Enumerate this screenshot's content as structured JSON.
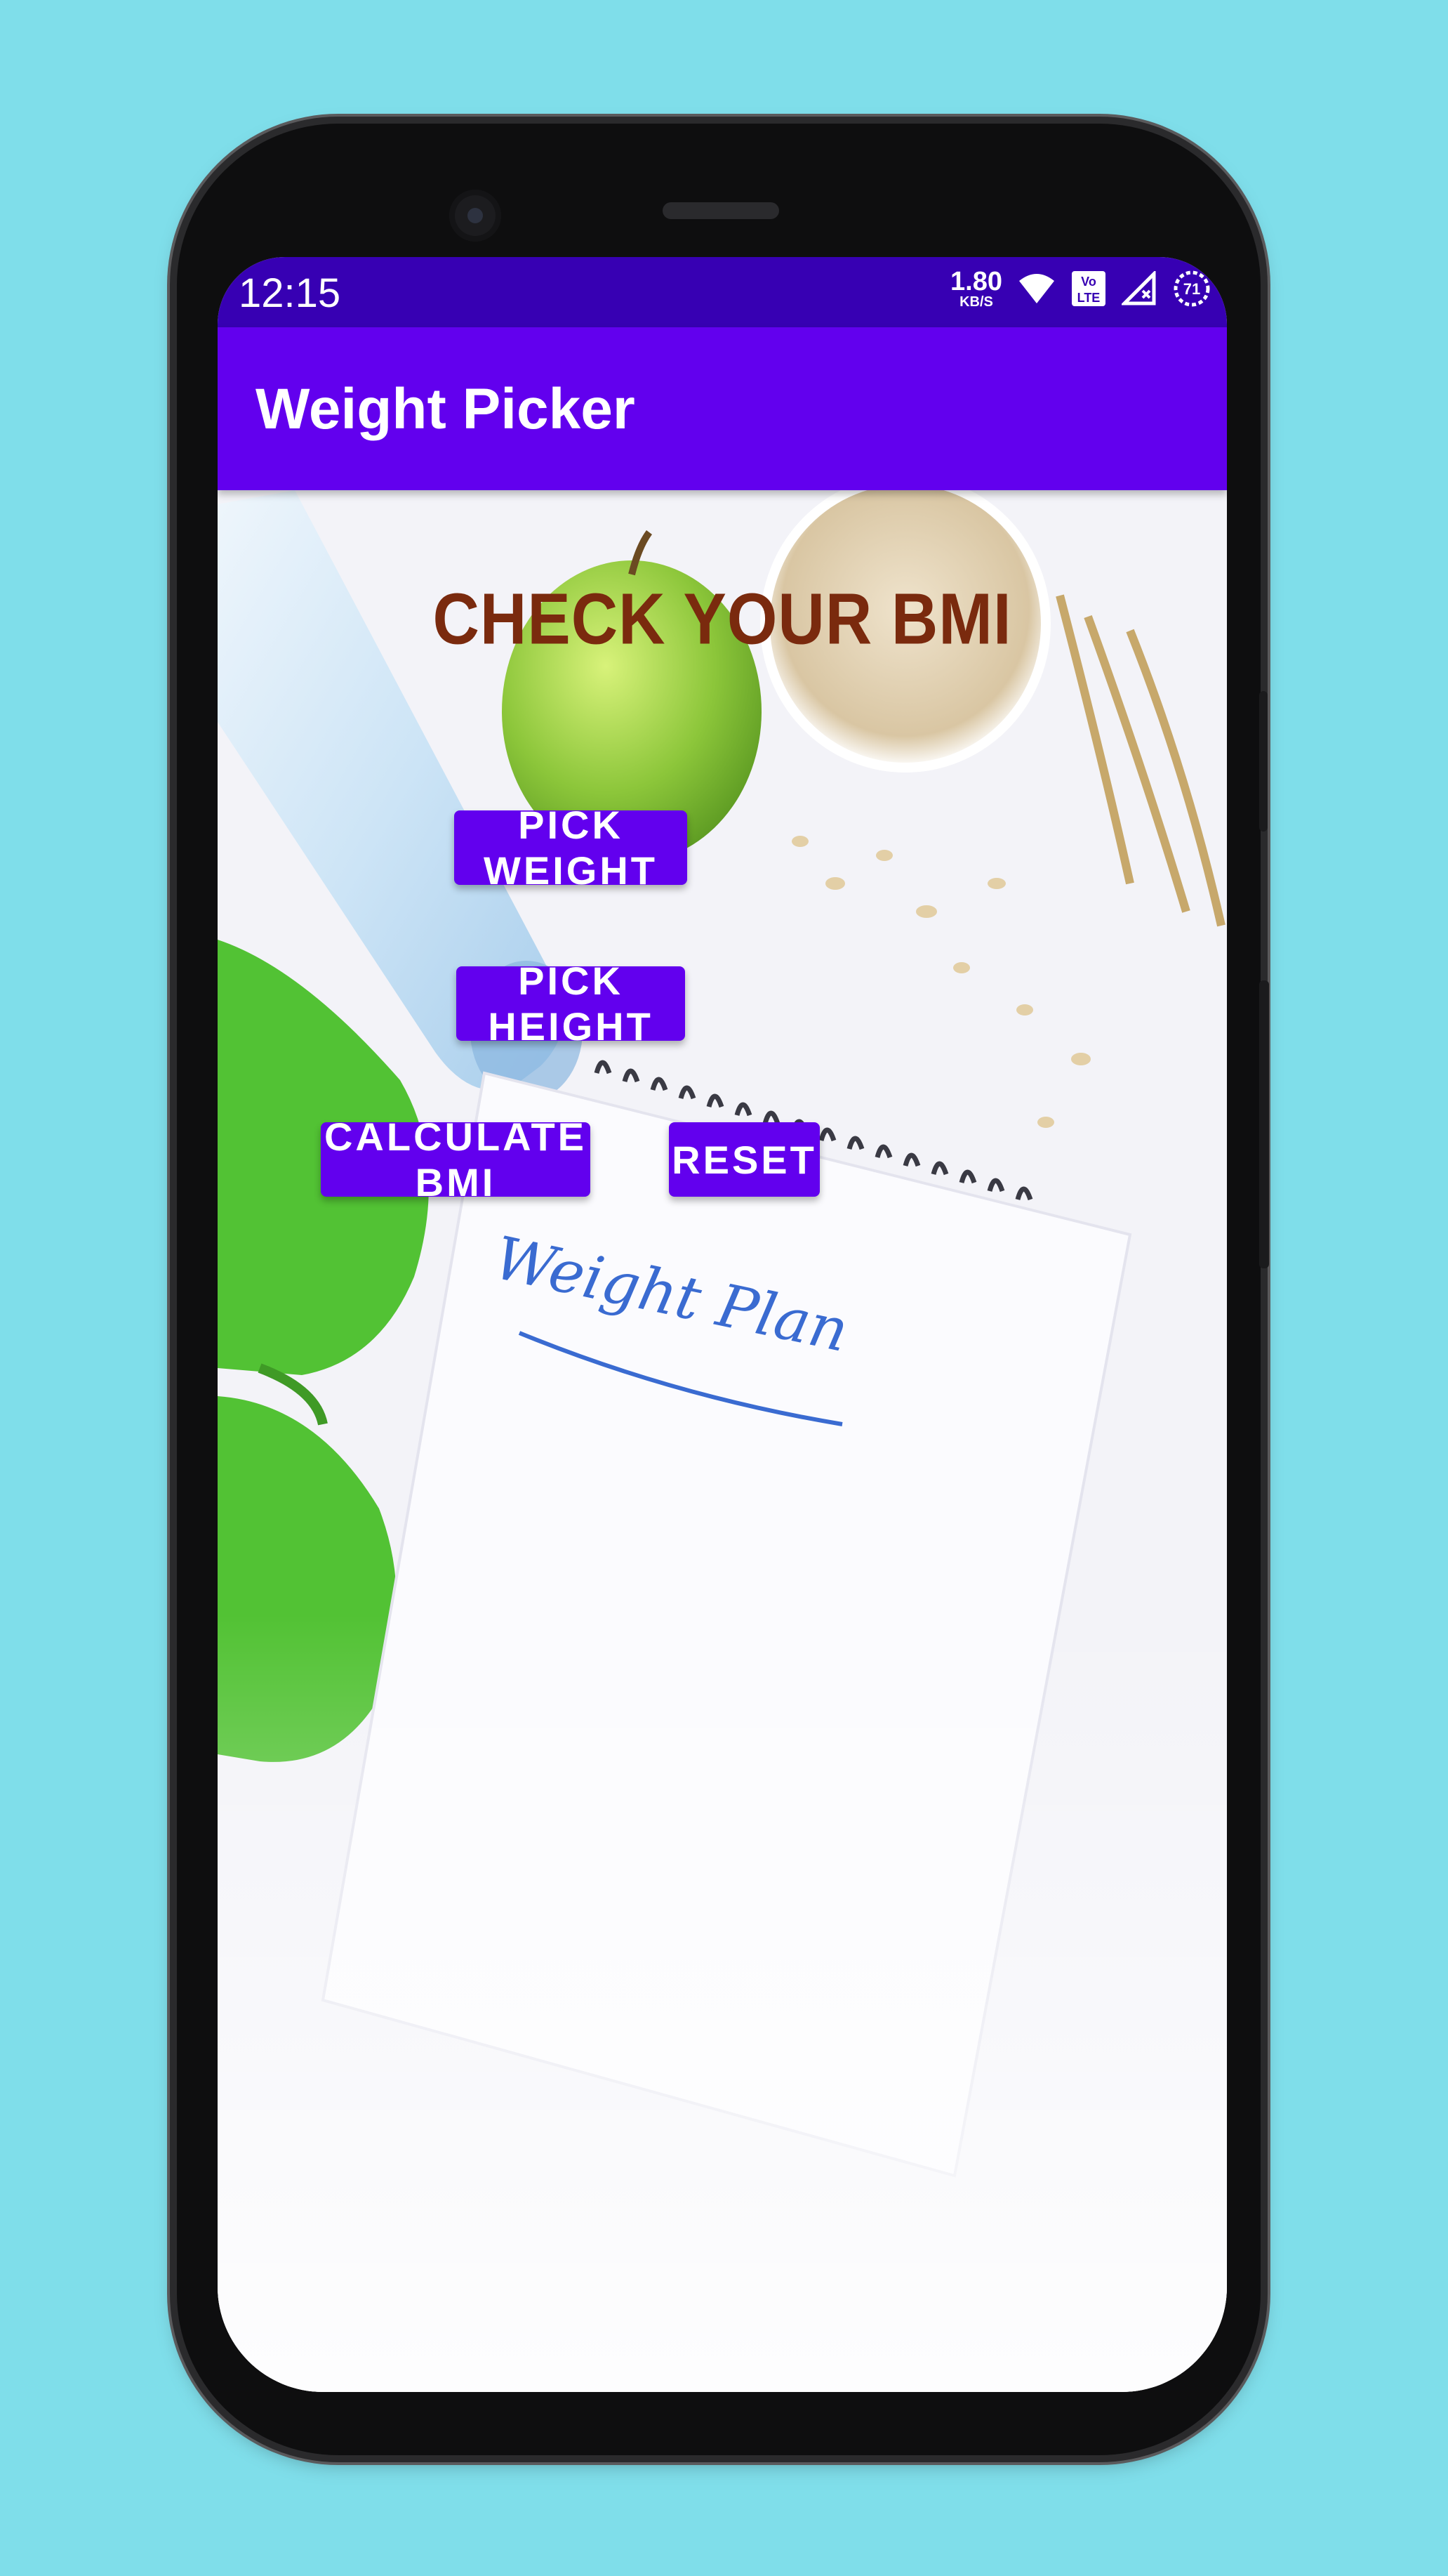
{
  "status_bar": {
    "time": "12:15",
    "net_speed": "1.80",
    "net_speed_unit": "KB/S",
    "volte_label": "Vo LTE",
    "battery": "71",
    "icons": [
      "wifi-icon",
      "volte-icon",
      "signal-icon",
      "battery-icon"
    ]
  },
  "app_bar": {
    "title": "Weight Picker"
  },
  "main": {
    "headline": "CHECK YOUR BMI",
    "buttons": {
      "pick_weight": "PICK WEIGHT",
      "pick_height": "PICK HEIGHT",
      "calculate_bmi": "CALCULATE BMI",
      "reset": "RESET"
    },
    "background_image": "fitness-weight-plan-photo",
    "note_text": "Weight Plan"
  },
  "colors": {
    "background": "#7fdeea",
    "status_bar": "#3700b3",
    "app_bar": "#6200ee",
    "button": "#6200ee",
    "headline": "#7a2a0e"
  }
}
